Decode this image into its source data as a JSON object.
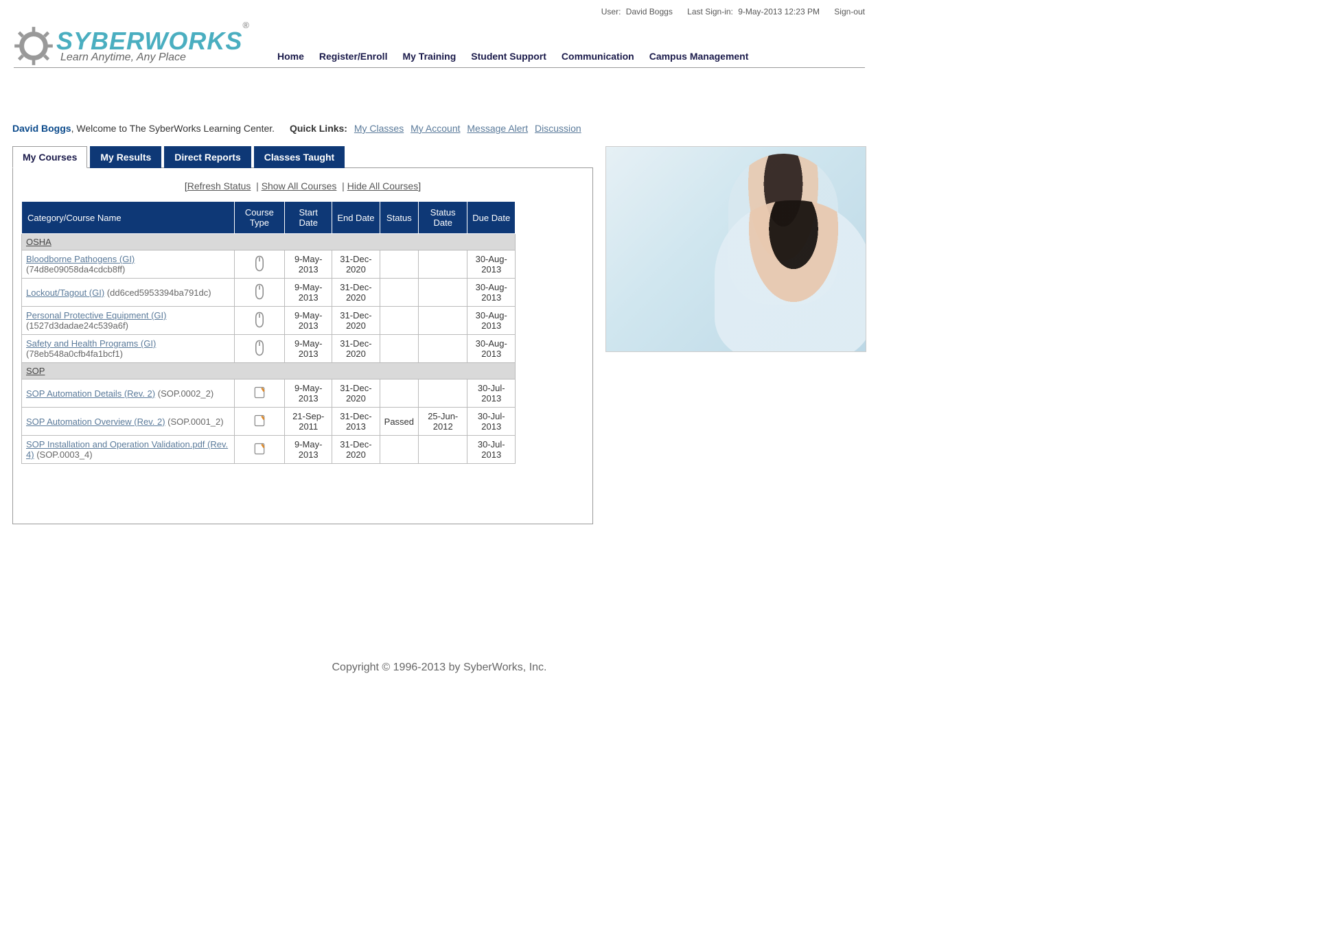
{
  "topbar": {
    "user_label": "User:",
    "user_name": "David Boggs",
    "signin_label": "Last Sign-in:",
    "signin_value": "9-May-2013 12:23 PM",
    "signout": "Sign-out"
  },
  "brand": {
    "name": "SYBERWORKS",
    "reg": "®",
    "tagline": "Learn Anytime, Any Place"
  },
  "nav": {
    "items": [
      "Home",
      "Register/Enroll",
      "My Training",
      "Student Support",
      "Communication",
      "Campus Management"
    ]
  },
  "welcome": {
    "user": "David Boggs",
    "text": ", Welcome to The SyberWorks Learning Center.",
    "quick_label": "Quick Links:",
    "links": [
      "My Classes",
      "My Account",
      "Message Alert",
      "Discussion"
    ]
  },
  "tabs": [
    "My Courses",
    "My Results",
    "Direct Reports",
    "Classes Taught"
  ],
  "actions": {
    "refresh": "Refresh Status",
    "show_all": "Show All Courses",
    "hide_all": "Hide All Courses"
  },
  "table": {
    "headers": [
      "Category/Course Name",
      "Course Type",
      "Start Date",
      "End Date",
      "Status",
      "Status Date",
      "Due Date"
    ],
    "groups": [
      {
        "category": "OSHA",
        "rows": [
          {
            "name": "Bloodborne Pathogens (GI)",
            "code": "(74d8e09058da4cdcb8ff)",
            "type": "mouse",
            "start": "9-May-2013",
            "end": "31-Dec-2020",
            "status": "",
            "status_date": "",
            "due": "30-Aug-2013"
          },
          {
            "name": "Lockout/Tagout (GI)",
            "code": "(dd6ced5953394ba791dc)",
            "type": "mouse",
            "start": "9-May-2013",
            "end": "31-Dec-2020",
            "status": "",
            "status_date": "",
            "due": "30-Aug-2013"
          },
          {
            "name": "Personal Protective Equipment (GI)",
            "code": "(1527d3dadae24c539a6f)",
            "type": "mouse",
            "start": "9-May-2013",
            "end": "31-Dec-2020",
            "status": "",
            "status_date": "",
            "due": "30-Aug-2013"
          },
          {
            "name": "Safety and Health Programs (GI)",
            "code": "(78eb548a0cfb4fa1bcf1)",
            "type": "mouse",
            "start": "9-May-2013",
            "end": "31-Dec-2020",
            "status": "",
            "status_date": "",
            "due": "30-Aug-2013"
          }
        ]
      },
      {
        "category": "SOP",
        "rows": [
          {
            "name": "SOP Automation Details (Rev. 2)",
            "code": "(SOP.0002_2)",
            "type": "doc",
            "start": "9-May-2013",
            "end": "31-Dec-2020",
            "status": "",
            "status_date": "",
            "due": "30-Jul-2013"
          },
          {
            "name": "SOP Automation Overview (Rev. 2)",
            "code": "(SOP.0001_2)",
            "type": "doc",
            "start": "21-Sep-2011",
            "end": "31-Dec-2013",
            "status": "Passed",
            "status_date": "25-Jun-2012",
            "due": "30-Jul-2013"
          },
          {
            "name": "SOP Installation and Operation Validation.pdf (Rev. 4)",
            "code": "(SOP.0003_4)",
            "type": "doc",
            "start": "9-May-2013",
            "end": "31-Dec-2020",
            "status": "",
            "status_date": "",
            "due": "30-Jul-2013"
          }
        ]
      }
    ]
  },
  "footer": "Copyright © 1996-2013 by SyberWorks, Inc."
}
